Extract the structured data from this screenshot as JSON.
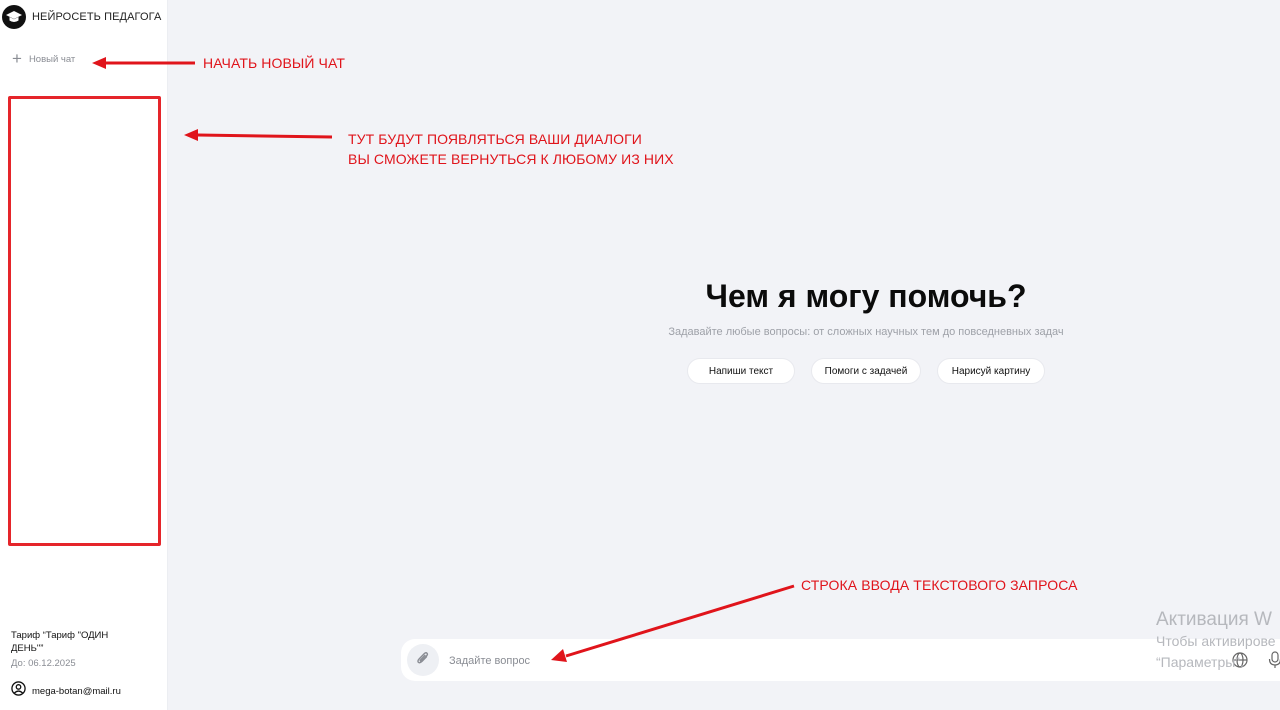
{
  "sidebar": {
    "brand": {
      "name": "НЕЙРОСЕТЬ ПЕДАГОГА",
      "icon": "graduation-cap-icon"
    },
    "new_chat": {
      "label": "Новый чат",
      "icon": "plus-icon"
    },
    "tariff": {
      "name": "Тариф “Тариф \"ОДИН ДЕНЬ\"”",
      "valid_until": "До: 06.12.2025"
    },
    "account": {
      "email": "mega-botan@mail.ru",
      "icon": "user-circle-icon"
    }
  },
  "main": {
    "title": "Чем я могу помочь?",
    "subtitle": "Задавайте любые вопросы: от сложных научных тем до повседневных задач",
    "suggestions": [
      "Напиши текст",
      "Помоги с задачей",
      "Нарисуй картину"
    ]
  },
  "composer": {
    "placeholder": "Задайте вопрос",
    "attach_icon": "paperclip-icon",
    "web_icon": "globe-icon",
    "voice_icon": "microphone-icon"
  },
  "annotations": {
    "new_chat": "НАЧАТЬ НОВЫЙ ЧАТ",
    "dialogs_line1": "ТУТ БУДУТ ПОЯВЛЯТЬСЯ ВАШИ ДИАЛОГИ",
    "dialogs_line2": "ВЫ СМОЖЕТЕ ВЕРНУТЬСЯ К ЛЮБОМУ ИЗ НИХ",
    "input_row": "СТРОКА ВВОДА ТЕКСТОВОГО ЗАПРОСА",
    "color": "#e0141b"
  },
  "watermark": {
    "title": "Активация W",
    "line1": "Чтобы активирове",
    "line2": "“Параметры”."
  },
  "colors": {
    "background": "#f2f3f7",
    "sidebar": "#ffffff",
    "highlight_box": "#e5252a"
  }
}
